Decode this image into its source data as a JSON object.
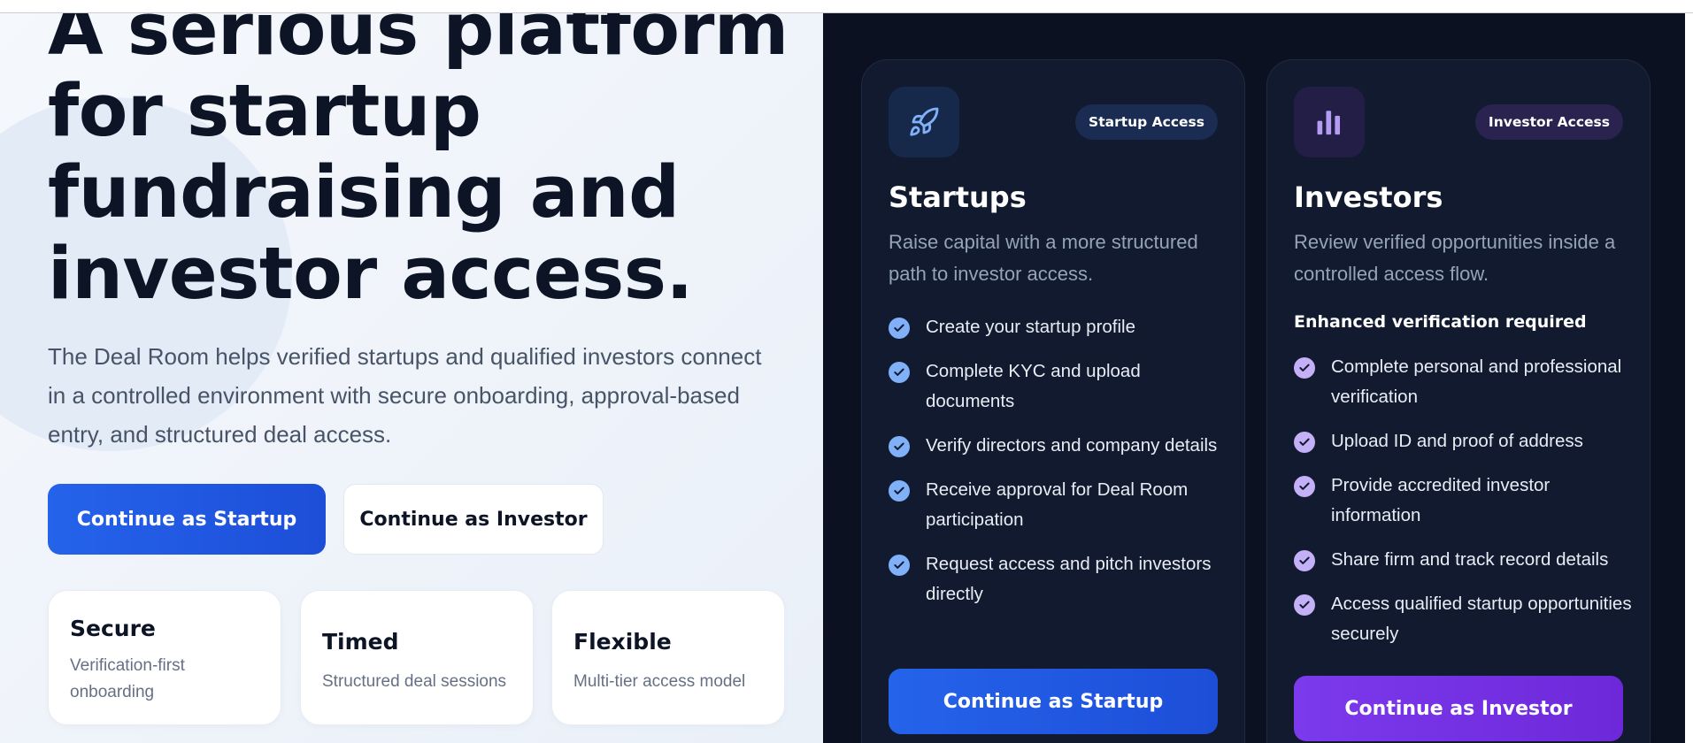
{
  "hero": {
    "title_lines": [
      "A serious platform",
      "for startup",
      "fundraising and",
      "investor access."
    ],
    "description": "The Deal Room helps verified startups and qualified investors connect in a controlled environment with secure onboarding, approval-based entry, and structured deal access.",
    "startup_button": "Continue as Startup",
    "investor_button": "Continue as Investor"
  },
  "features": [
    {
      "title": "Secure",
      "subtitle": "Verification-first onboarding"
    },
    {
      "title": "Timed",
      "subtitle": "Structured deal sessions"
    },
    {
      "title": "Flexible",
      "subtitle": "Multi-tier access model"
    }
  ],
  "startup_card": {
    "icon": "rocket-icon",
    "badge": "Startup Access",
    "title": "Startups",
    "description": "Raise capital with a more structured path to investor access.",
    "items": [
      "Create your startup profile",
      "Complete KYC and upload documents",
      "Verify directors and company details",
      "Receive approval for Deal Room participation",
      "Request access and pitch investors directly"
    ],
    "button": "Continue as Startup"
  },
  "investor_card": {
    "icon": "bar-chart-icon",
    "badge": "Investor Access",
    "title": "Investors",
    "description": "Review verified opportunities inside a controlled access flow.",
    "requirement": "Enhanced verification required",
    "items": [
      "Complete personal and professional verification",
      "Upload ID and proof of address",
      "Provide accredited investor information",
      "Share firm and track record details",
      "Access qualified startup opportunities securely"
    ],
    "button": "Continue as Investor"
  },
  "colors": {
    "primary_blue": "#2563eb",
    "primary_purple": "#7c3aed",
    "dark_bg": "#0b1120",
    "card_bg": "#111a2e",
    "heading": "#0c1426"
  }
}
